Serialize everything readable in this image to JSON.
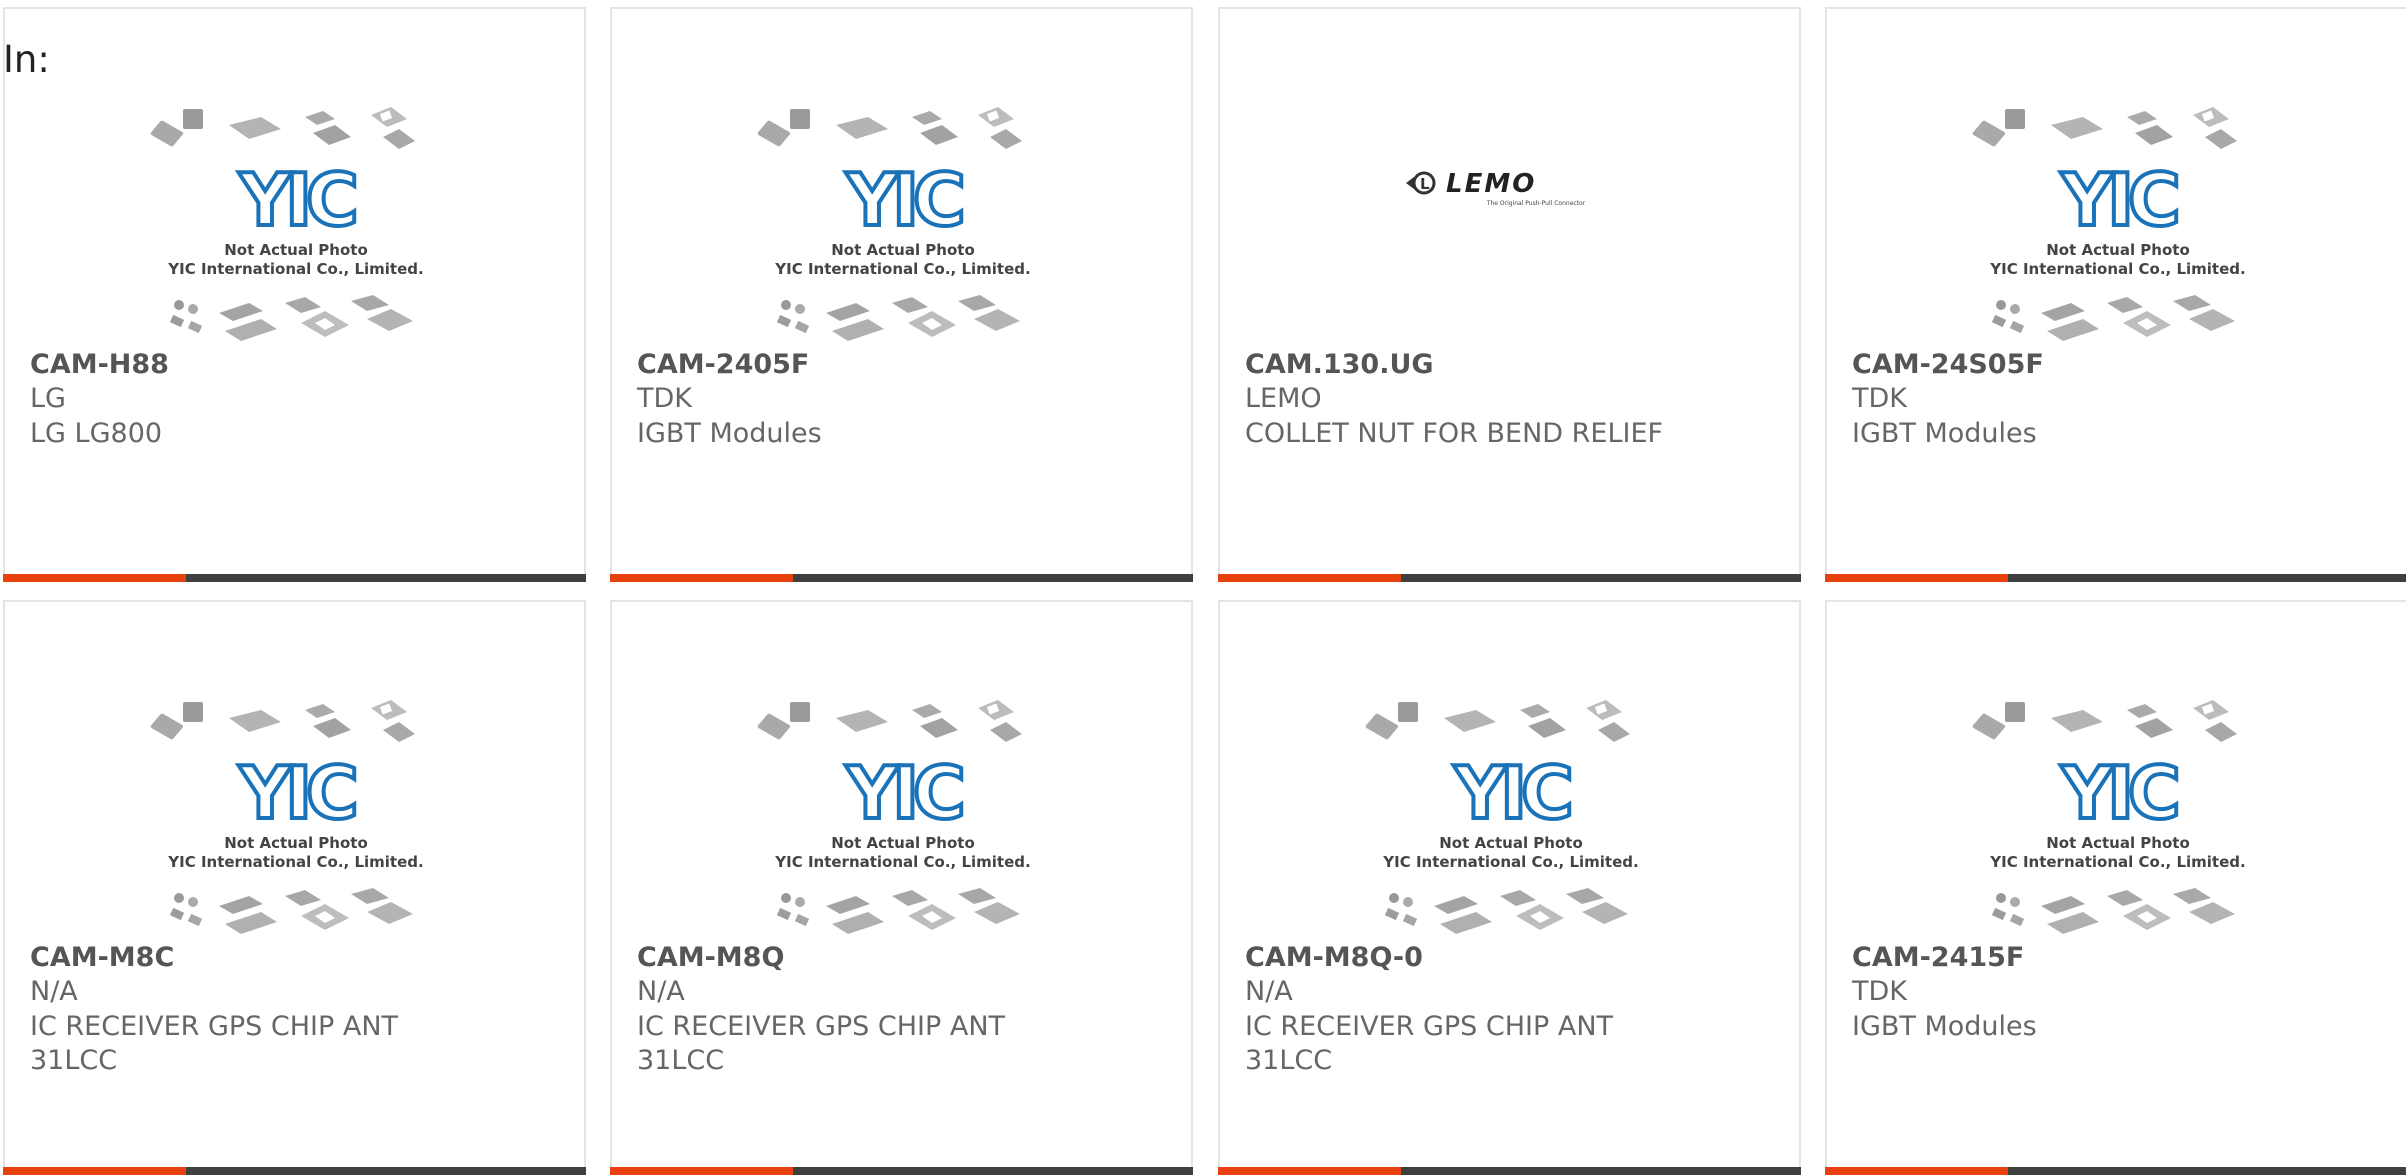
{
  "header": {
    "label": "In:"
  },
  "image_caption": {
    "line1": "Not Actual Photo",
    "line2": "YIC International Co., Limited.",
    "brand": "YIC"
  },
  "lemo_logo": {
    "brand": "LEMO",
    "tagline": "The Original Push-Pull Connector"
  },
  "colors": {
    "accent": "#e8410d",
    "bar": "#404040",
    "yic_blue": "#1a72b8",
    "border": "#e4e4e4"
  },
  "products": [
    {
      "part": "CAM-H88",
      "manufacturer": "LG",
      "description": "LG LG800",
      "image": "placeholder"
    },
    {
      "part": "CAM-2405F",
      "manufacturer": "TDK",
      "description": "IGBT Modules",
      "image": "placeholder"
    },
    {
      "part": "CAM.130.UG",
      "manufacturer": "LEMO",
      "description": "COLLET NUT FOR BEND RELIEF",
      "image": "lemo"
    },
    {
      "part": "CAM-24S05F",
      "manufacturer": "TDK",
      "description": "IGBT Modules",
      "image": "placeholder"
    },
    {
      "part": "CAM-M8C",
      "manufacturer": "N/A",
      "description": "IC RECEIVER GPS CHIP ANT 31LCC",
      "image": "placeholder"
    },
    {
      "part": "CAM-M8Q",
      "manufacturer": "N/A",
      "description": "IC RECEIVER GPS CHIP ANT 31LCC",
      "image": "placeholder"
    },
    {
      "part": "CAM-M8Q-0",
      "manufacturer": "N/A",
      "description": "IC RECEIVER GPS CHIP ANT 31LCC",
      "image": "placeholder"
    },
    {
      "part": "CAM-2415F",
      "manufacturer": "TDK",
      "description": "IGBT Modules",
      "image": "placeholder"
    }
  ]
}
